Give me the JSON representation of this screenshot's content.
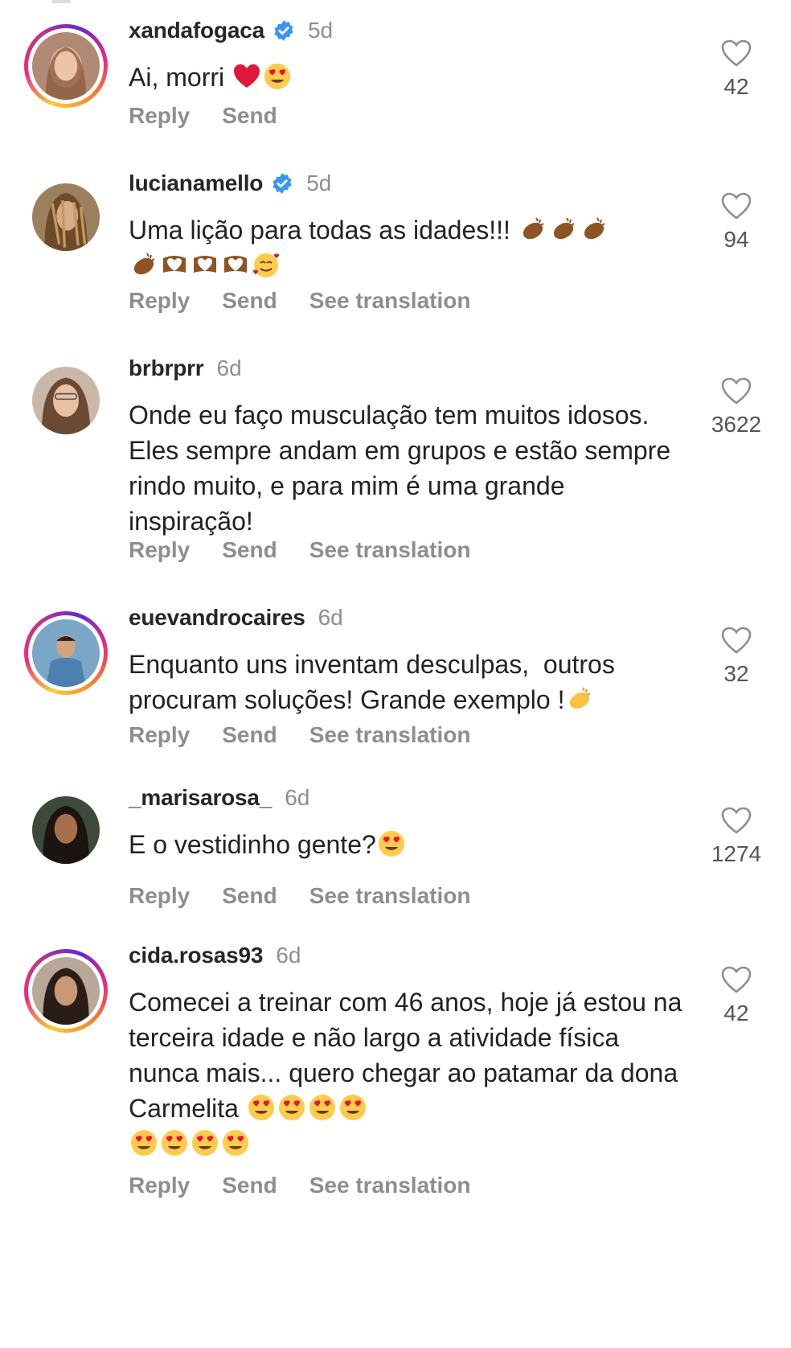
{
  "actions": {
    "reply": "Reply",
    "send": "Send",
    "see_translation": "See translation"
  },
  "colors": {
    "verified": "#3897f0",
    "muted": "#8e8e8e",
    "heart_red": "#e0163a"
  },
  "comments": [
    {
      "username": "xandafogaca",
      "verified": true,
      "time": "5d",
      "text": "Ai, morri",
      "emojis": [
        "red-heart-emoji",
        "heart-eyes-emoji"
      ],
      "likes": "42",
      "has_translation": false
    },
    {
      "username": "lucianamello",
      "verified": true,
      "time": "5d",
      "text": "Uma lição para todas as idades!!!",
      "emojis": [
        "clap-emoji",
        "clap-emoji",
        "clap-emoji",
        "clap-emoji",
        "heart-hands-emoji",
        "heart-hands-emoji",
        "heart-hands-emoji",
        "smiling-hearts-emoji"
      ],
      "likes": "94",
      "has_translation": true
    },
    {
      "username": "brbrprr",
      "verified": false,
      "time": "6d",
      "text": "Onde eu faço musculação tem muitos idosos. Eles sempre andam em grupos e estão sempre rindo muito, e para mim é uma grande inspiração!",
      "emojis": [],
      "likes": "3622",
      "has_translation": true
    },
    {
      "username": "euevandrocaires",
      "verified": false,
      "time": "6d",
      "text": "Enquanto uns inventam desculpas,  outros procuram soluções! Grande exemplo !",
      "emojis": [
        "clap-emoji"
      ],
      "likes": "32",
      "has_translation": true
    },
    {
      "username": "_marisarosa_",
      "verified": false,
      "time": "6d",
      "text": "E o vestidinho gente?",
      "emojis": [
        "heart-eyes-emoji"
      ],
      "likes": "1274",
      "has_translation": true
    },
    {
      "username": "cida.rosas93",
      "verified": false,
      "time": "6d",
      "text": "Comecei a treinar com 46 anos, hoje já estou na terceira idade e não largo a atividade física nunca mais... quero chegar ao patamar da dona Carmelita",
      "emojis": [
        "heart-eyes-emoji",
        "heart-eyes-emoji",
        "heart-eyes-emoji",
        "heart-eyes-emoji",
        "heart-eyes-emoji",
        "heart-eyes-emoji",
        "heart-eyes-emoji",
        "heart-eyes-emoji"
      ],
      "likes": "42",
      "has_translation": true
    }
  ]
}
